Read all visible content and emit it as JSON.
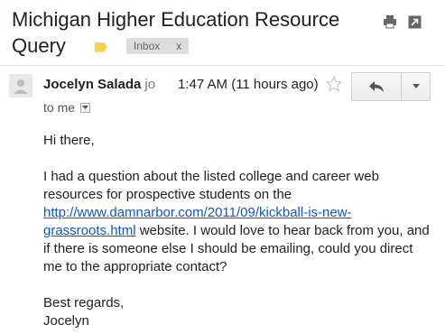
{
  "email": {
    "subject_line1": "Michigan Higher Education Resource",
    "subject_line2": "Query",
    "label_chip": "Inbox",
    "label_chip_close": "x",
    "label_color": "#f5d44b",
    "sender_name": "Jocelyn Salada",
    "sender_email_truncated": "jo",
    "timestamp": "1:47 AM (11 hours ago)",
    "recipient": "to me",
    "body": {
      "greeting": "Hi there,",
      "para_before_link": "I had a question about the listed college and career web resources for prospective students on the ",
      "link": "http://www.damnarbor.com/2011/09/kickball-is-new-grassroots.html",
      "para_after_link": " website. I would love to hear back from you, and if there is someone else I should be emailing, could you direct me to the appropriate contact?",
      "closing": "Best regards,",
      "signature": "Jocelyn"
    }
  },
  "icons": {
    "print": "print-icon",
    "new_window": "open-in-new-window-icon",
    "avatar": "person-icon",
    "star": "star-icon",
    "reply": "reply-arrow-icon",
    "more": "chevron-down-icon",
    "recipient_details": "caret-down-icon"
  },
  "colors": {
    "link": "#1155cc",
    "chip_bg": "#dddddd"
  }
}
